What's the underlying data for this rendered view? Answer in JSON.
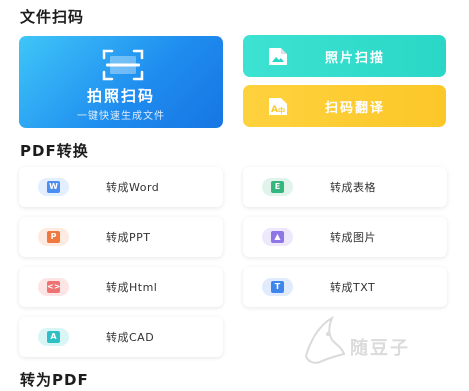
{
  "sections": {
    "doc_scan": "文件扫码",
    "pdf_convert": "PDF转换",
    "to_pdf": "转为PDF"
  },
  "scan_card": {
    "title": "拍照扫码",
    "subtitle": "一键快速生成文件"
  },
  "quick_actions": [
    {
      "label": "照片扫描",
      "icon": "photo-icon"
    },
    {
      "label": "扫码翻译",
      "icon": "translate-icon"
    }
  ],
  "tools": [
    {
      "label": "转成Word",
      "icon": "word-icon",
      "glyph": "W"
    },
    {
      "label": "转成表格",
      "icon": "excel-icon",
      "glyph": "E"
    },
    {
      "label": "转成PPT",
      "icon": "ppt-icon",
      "glyph": "P"
    },
    {
      "label": "转成图片",
      "icon": "image-icon",
      "glyph": "▲"
    },
    {
      "label": "转成Html",
      "icon": "html-icon",
      "glyph": "<>"
    },
    {
      "label": "转成TXT",
      "icon": "txt-icon",
      "glyph": "T"
    },
    {
      "label": "转成CAD",
      "icon": "cad-icon",
      "glyph": "A"
    }
  ],
  "watermark": "随豆子",
  "colors": {
    "scan_card": "#1e8bef",
    "photo_card": "#2ad7c6",
    "translate_card": "#fcc728"
  }
}
